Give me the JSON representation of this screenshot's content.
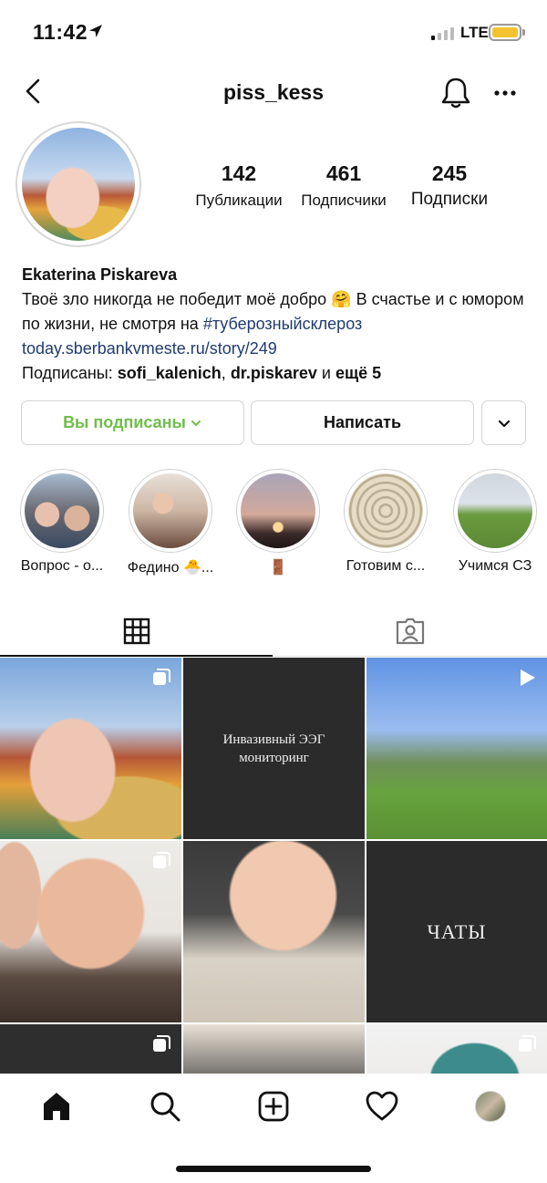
{
  "status_bar": {
    "time": "11:42",
    "network": "LTE",
    "battery_color": "#f2c230"
  },
  "header": {
    "username": "piss_kess",
    "back_icon": "chevron-left-icon",
    "bell_icon": "bell-icon",
    "more_icon": "more-horizontal-icon"
  },
  "profile": {
    "stats": {
      "posts_count": "142",
      "posts_label": "Публикации",
      "followers_count": "461",
      "followers_label": "Подписчики",
      "following_count": "245",
      "following_label": "Подписки"
    },
    "name": "Ekaterina Piskareva",
    "bio_text_1": "Твоё зло никогда не победит моё добро 🤗 В счастье и с юмором по жизни, не смотря на ",
    "bio_hashtag": "#туберозныйсклероз",
    "bio_link": "today.sberbankvmeste.ru/story/249",
    "followed_by_prefix": "Подписаны: ",
    "followed_by_user1": "sofi_kalenich",
    "followed_by_sep": ", ",
    "followed_by_user2": "dr.piskarev",
    "followed_by_and": " и ",
    "followed_by_more": "ещё 5"
  },
  "actions": {
    "following_label": "Вы подписаны",
    "message_label": "Написать",
    "following_color": "#6fbe4a"
  },
  "highlights": [
    {
      "label": "Вопрос - о..."
    },
    {
      "label": "Федино 🐣..."
    },
    {
      "label": "🚪"
    },
    {
      "label": "Готовим с..."
    },
    {
      "label": "Учимся СЗ"
    }
  ],
  "tabs": {
    "grid_icon": "grid-icon",
    "tagged_icon": "tagged-user-icon"
  },
  "posts": [
    {
      "type": "carousel"
    },
    {
      "type": "highlight-cover",
      "text": "Инвазивный ЭЭГ мониторинг"
    },
    {
      "type": "video"
    },
    {
      "type": "carousel"
    },
    {
      "type": "photo"
    },
    {
      "type": "text-cover",
      "text": "ЧАТЫ"
    },
    {
      "type": "carousel"
    },
    {
      "type": "photo"
    },
    {
      "type": "carousel"
    }
  ],
  "bottom_nav": [
    "home-icon",
    "search-icon",
    "add-post-icon",
    "heart-icon",
    "profile-avatar"
  ]
}
